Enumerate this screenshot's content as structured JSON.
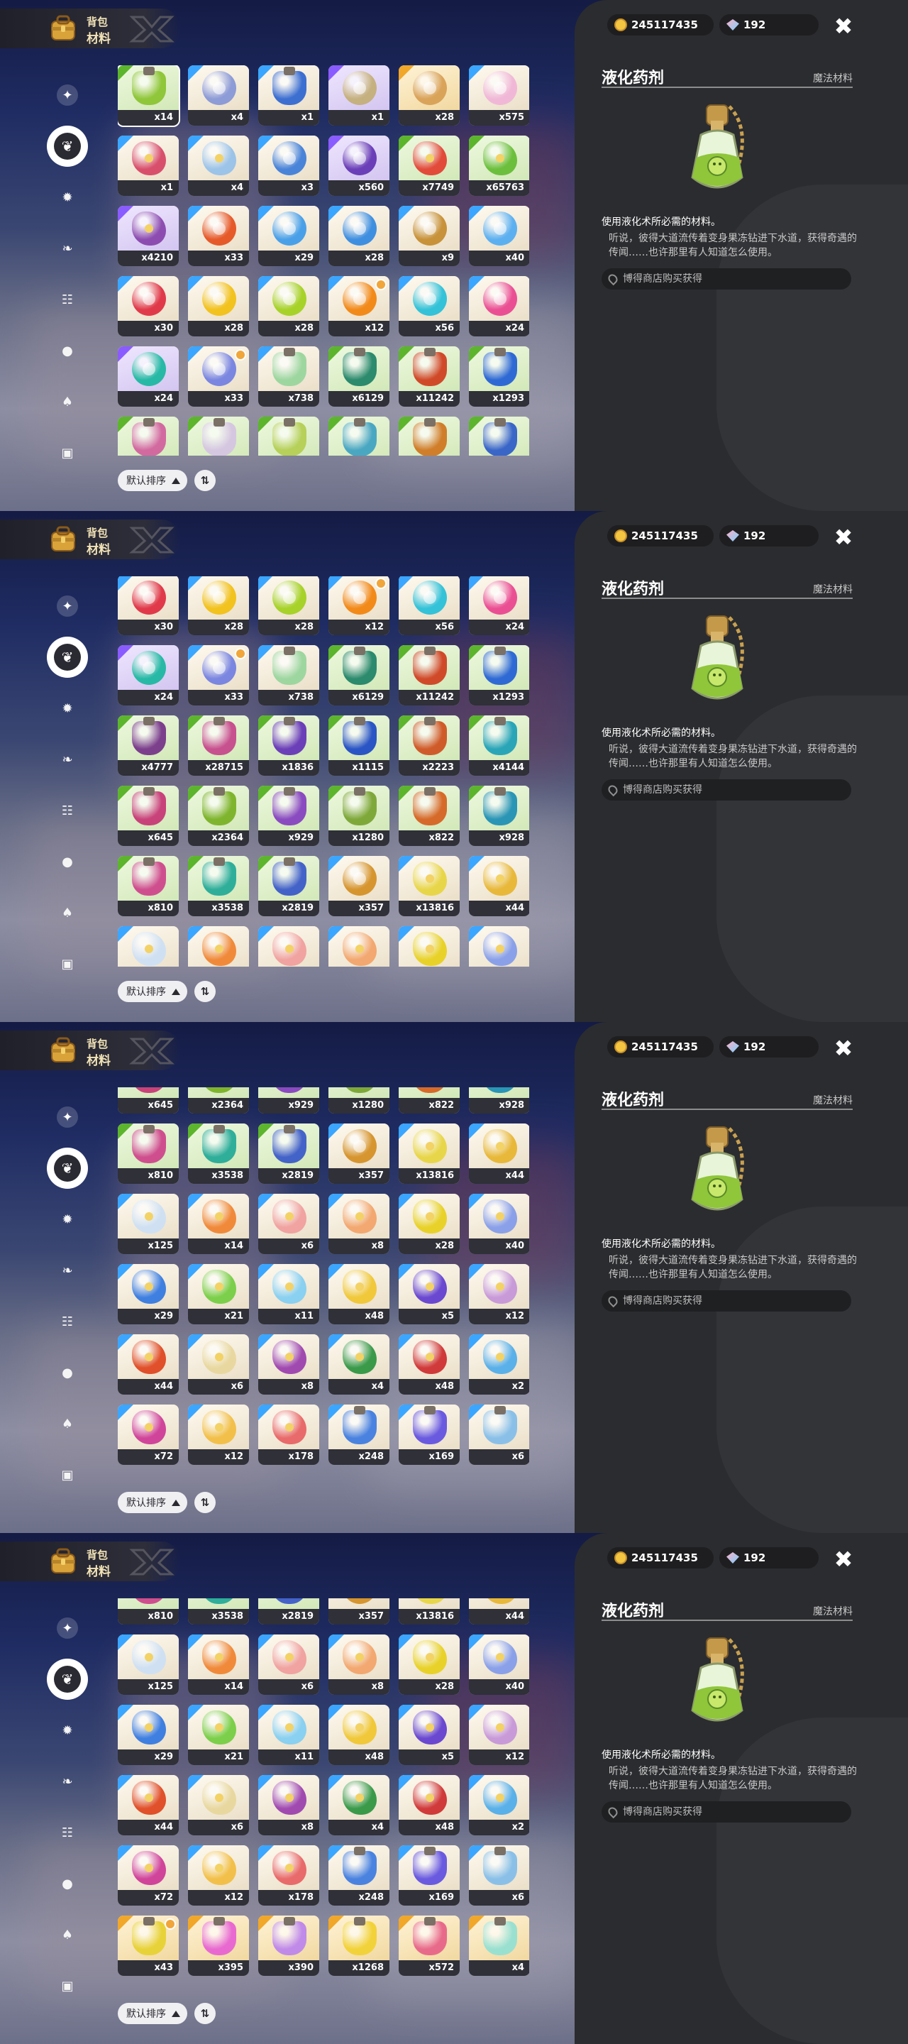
{
  "header": {
    "line1": "背包",
    "line2": "材料"
  },
  "currency": {
    "coins": "245117435",
    "gems": "192"
  },
  "close_label": "✖",
  "categories": [
    {
      "name": "star",
      "glyph": "✦"
    },
    {
      "name": "leaf",
      "glyph": "❦"
    },
    {
      "name": "gear",
      "glyph": "✹"
    },
    {
      "name": "feather",
      "glyph": "❧"
    },
    {
      "name": "chart",
      "glyph": "☷"
    },
    {
      "name": "ball",
      "glyph": "●"
    },
    {
      "name": "bell",
      "glyph": "♠"
    },
    {
      "name": "chest",
      "glyph": "▣"
    }
  ],
  "sort": {
    "label": "默认排序",
    "order_label": "⇅"
  },
  "detail": {
    "name": "液化药剂",
    "type": "魔法材料",
    "desc": "使用液化术所必需的材料。",
    "lore": "听说，彼得大道流传着变身果冻钻进下水道，获得奇遇的传闻……也许那里有人知道怎么使用。",
    "source": "博得商店购买获得"
  },
  "frames": [
    {
      "offset": 0,
      "cells": [
        {
          "c": "x14",
          "col": "#8fc63a",
          "shape": "bottle",
          "r": "green",
          "sel": true
        },
        {
          "c": "x4",
          "col": "#8d9bd6",
          "shape": "ring",
          "r": "blue"
        },
        {
          "c": "x1",
          "col": "#3d6fd1",
          "shape": "bottle",
          "r": "blue"
        },
        {
          "c": "x1",
          "col": "#c5b080",
          "shape": "ring",
          "r": "purple"
        },
        {
          "c": "x28",
          "col": "#d9a35a",
          "shape": "ring",
          "r": "gold"
        },
        {
          "c": "x575",
          "col": "#f0b8d6",
          "shape": "ring",
          "r": "blue"
        },
        {
          "c": "x1",
          "col": "#d84f6c",
          "shape": "flower",
          "r": "blue"
        },
        {
          "c": "x4",
          "col": "#9cc3e8",
          "shape": "flower",
          "r": "blue"
        },
        {
          "c": "x3",
          "col": "#4a84d8",
          "shape": "ring",
          "r": "blue"
        },
        {
          "c": "x560",
          "col": "#6b3fb8",
          "shape": "ring",
          "r": "purple"
        },
        {
          "c": "x7749",
          "col": "#e24a3a",
          "shape": "flower",
          "r": "green"
        },
        {
          "c": "x65763",
          "col": "#6cbf3c",
          "shape": "flower",
          "r": "green"
        },
        {
          "c": "x4210",
          "col": "#8d4db0",
          "shape": "flower",
          "r": "purple"
        },
        {
          "c": "x33",
          "col": "#e65a2a",
          "shape": "ring",
          "r": "blue"
        },
        {
          "c": "x29",
          "col": "#4aa0e8",
          "shape": "ring",
          "r": "blue"
        },
        {
          "c": "x28",
          "col": "#3f8fe0",
          "shape": "ring",
          "r": "blue"
        },
        {
          "c": "x9",
          "col": "#c7923a",
          "shape": "ring",
          "r": "blue"
        },
        {
          "c": "x40",
          "col": "#5db0f0",
          "shape": "ring",
          "r": "blue"
        },
        {
          "c": "x30",
          "col": "#e03a4a",
          "shape": "ring",
          "r": "blue"
        },
        {
          "c": "x28",
          "col": "#f2c21f",
          "shape": "ring",
          "r": "blue"
        },
        {
          "c": "x28",
          "col": "#a7d22a",
          "shape": "ring",
          "r": "blue"
        },
        {
          "c": "x12",
          "col": "#f28a1a",
          "shape": "ring",
          "r": "blue",
          "nw": true
        },
        {
          "c": "x56",
          "col": "#34c2d8",
          "shape": "ring",
          "r": "blue"
        },
        {
          "c": "x24",
          "col": "#ea4f93",
          "shape": "ring",
          "r": "blue"
        },
        {
          "c": "x24",
          "col": "#27b9a5",
          "shape": "ring",
          "r": "purple"
        },
        {
          "c": "x33",
          "col": "#7a86e0",
          "shape": "ring",
          "r": "blue",
          "nw": true
        },
        {
          "c": "x738",
          "col": "#9ed6a0",
          "shape": "bottle",
          "r": "blue"
        },
        {
          "c": "x6129",
          "col": "#2c8a6d",
          "shape": "bottle",
          "r": "green"
        },
        {
          "c": "x11242",
          "col": "#d04a2a",
          "shape": "bottle",
          "r": "green"
        },
        {
          "c": "x1293",
          "col": "#2f6ad4",
          "shape": "bottle",
          "r": "green"
        },
        {
          "c": "",
          "col": "#d26aa0",
          "shape": "bottle",
          "r": "green"
        },
        {
          "c": "",
          "col": "#d5c7e0",
          "shape": "bottle",
          "r": "green"
        },
        {
          "c": "",
          "col": "#b6d05a",
          "shape": "bottle",
          "r": "green"
        },
        {
          "c": "",
          "col": "#4aa7c2",
          "shape": "bottle",
          "r": "green"
        },
        {
          "c": "",
          "col": "#d07e2a",
          "shape": "bottle",
          "r": "green"
        },
        {
          "c": "",
          "col": "#3a66c8",
          "shape": "bottle",
          "r": "green"
        }
      ]
    },
    {
      "offset": -2,
      "cells": [
        {
          "c": "x30",
          "col": "#e03a4a",
          "shape": "ring",
          "r": "blue"
        },
        {
          "c": "x28",
          "col": "#f2c21f",
          "shape": "ring",
          "r": "blue"
        },
        {
          "c": "x28",
          "col": "#a7d22a",
          "shape": "ring",
          "r": "blue"
        },
        {
          "c": "x12",
          "col": "#f28a1a",
          "shape": "ring",
          "r": "blue",
          "nw": true
        },
        {
          "c": "x56",
          "col": "#34c2d8",
          "shape": "ring",
          "r": "blue"
        },
        {
          "c": "x24",
          "col": "#ea4f93",
          "shape": "ring",
          "r": "blue"
        },
        {
          "c": "x24",
          "col": "#27b9a5",
          "shape": "ring",
          "r": "purple"
        },
        {
          "c": "x33",
          "col": "#7a86e0",
          "shape": "ring",
          "r": "blue",
          "nw": true
        },
        {
          "c": "x738",
          "col": "#9ed6a0",
          "shape": "bottle",
          "r": "blue"
        },
        {
          "c": "x6129",
          "col": "#2c8a6d",
          "shape": "bottle",
          "r": "green"
        },
        {
          "c": "x11242",
          "col": "#d04a2a",
          "shape": "bottle",
          "r": "green"
        },
        {
          "c": "x1293",
          "col": "#2f6ad4",
          "shape": "bottle",
          "r": "green"
        },
        {
          "c": "x4777",
          "col": "#7c3f8c",
          "shape": "bottle",
          "r": "green"
        },
        {
          "c": "x28715",
          "col": "#c7508e",
          "shape": "bottle",
          "r": "green"
        },
        {
          "c": "x1836",
          "col": "#6b3fb8",
          "shape": "bottle",
          "r": "green"
        },
        {
          "c": "x1115",
          "col": "#2a55c4",
          "shape": "bottle",
          "r": "green"
        },
        {
          "c": "x2223",
          "col": "#d05b2a",
          "shape": "bottle",
          "r": "green"
        },
        {
          "c": "x4144",
          "col": "#2aa5b8",
          "shape": "bottle",
          "r": "green"
        },
        {
          "c": "x645",
          "col": "#c8437a",
          "shape": "bottle",
          "r": "green"
        },
        {
          "c": "x2364",
          "col": "#7fb52e",
          "shape": "bottle",
          "r": "green"
        },
        {
          "c": "x929",
          "col": "#8a4bc0",
          "shape": "bottle",
          "r": "green"
        },
        {
          "c": "x1280",
          "col": "#7fa83a",
          "shape": "bottle",
          "r": "green"
        },
        {
          "c": "x822",
          "col": "#d66a2a",
          "shape": "bottle",
          "r": "green"
        },
        {
          "c": "x928",
          "col": "#2a95b5",
          "shape": "bottle",
          "r": "green"
        },
        {
          "c": "x810",
          "col": "#cf4f8e",
          "shape": "bottle",
          "r": "green"
        },
        {
          "c": "x3538",
          "col": "#2fae9a",
          "shape": "bottle",
          "r": "green"
        },
        {
          "c": "x2819",
          "col": "#4463c8",
          "shape": "bottle",
          "r": "green"
        },
        {
          "c": "x357",
          "col": "#d6952f",
          "shape": "ring",
          "r": "blue"
        },
        {
          "c": "x13816",
          "col": "#e8d64a",
          "shape": "flower",
          "r": "blue"
        },
        {
          "c": "x44",
          "col": "#e8b83a",
          "shape": "flower",
          "r": "blue"
        },
        {
          "c": "",
          "col": "#cfe0f2",
          "shape": "flower",
          "r": "blue"
        },
        {
          "c": "",
          "col": "#f08a3a",
          "shape": "flower",
          "r": "blue"
        },
        {
          "c": "",
          "col": "#f0a3a0",
          "shape": "flower",
          "r": "blue"
        },
        {
          "c": "",
          "col": "#f2a870",
          "shape": "flower",
          "r": "blue"
        },
        {
          "c": "",
          "col": "#e8d22a",
          "shape": "flower",
          "r": "blue"
        },
        {
          "c": "",
          "col": "#8aa0e8",
          "shape": "flower",
          "r": "blue"
        }
      ]
    },
    {
      "offset": -48,
      "cells": [
        {
          "c": "x645",
          "col": "#c8437a",
          "shape": "bottle",
          "r": "green"
        },
        {
          "c": "x2364",
          "col": "#7fb52e",
          "shape": "bottle",
          "r": "green"
        },
        {
          "c": "x929",
          "col": "#8a4bc0",
          "shape": "bottle",
          "r": "green"
        },
        {
          "c": "x1280",
          "col": "#7fa83a",
          "shape": "bottle",
          "r": "green"
        },
        {
          "c": "x822",
          "col": "#d66a2a",
          "shape": "bottle",
          "r": "green"
        },
        {
          "c": "x928",
          "col": "#2a95b5",
          "shape": "bottle",
          "r": "green"
        },
        {
          "c": "x810",
          "col": "#cf4f8e",
          "shape": "bottle",
          "r": "green"
        },
        {
          "c": "x3538",
          "col": "#2fae9a",
          "shape": "bottle",
          "r": "green"
        },
        {
          "c": "x2819",
          "col": "#4463c8",
          "shape": "bottle",
          "r": "green"
        },
        {
          "c": "x357",
          "col": "#d6952f",
          "shape": "ring",
          "r": "blue"
        },
        {
          "c": "x13816",
          "col": "#e8d64a",
          "shape": "flower",
          "r": "blue"
        },
        {
          "c": "x44",
          "col": "#e8b83a",
          "shape": "flower",
          "r": "blue"
        },
        {
          "c": "x125",
          "col": "#cfe0f2",
          "shape": "flower",
          "r": "blue"
        },
        {
          "c": "x14",
          "col": "#f08a3a",
          "shape": "flower",
          "r": "blue"
        },
        {
          "c": "x6",
          "col": "#f0a3a0",
          "shape": "flower",
          "r": "blue"
        },
        {
          "c": "x8",
          "col": "#f2a870",
          "shape": "flower",
          "r": "blue"
        },
        {
          "c": "x28",
          "col": "#e8d22a",
          "shape": "flower",
          "r": "blue"
        },
        {
          "c": "x40",
          "col": "#8aa0e8",
          "shape": "flower",
          "r": "blue"
        },
        {
          "c": "x29",
          "col": "#3f7fe0",
          "shape": "flower",
          "r": "blue"
        },
        {
          "c": "x21",
          "col": "#7ccf4a",
          "shape": "flower",
          "r": "blue"
        },
        {
          "c": "x11",
          "col": "#8ad0f0",
          "shape": "flower",
          "r": "blue"
        },
        {
          "c": "x48",
          "col": "#f0c83a",
          "shape": "flower",
          "r": "blue"
        },
        {
          "c": "x5",
          "col": "#6a48d0",
          "shape": "flower",
          "r": "blue"
        },
        {
          "c": "x12",
          "col": "#c89ad8",
          "shape": "flower",
          "r": "blue"
        },
        {
          "c": "x44",
          "col": "#e0502a",
          "shape": "flower",
          "r": "blue"
        },
        {
          "c": "x6",
          "col": "#e8d8a0",
          "shape": "flower",
          "r": "blue"
        },
        {
          "c": "x8",
          "col": "#a04ab0",
          "shape": "flower",
          "r": "blue"
        },
        {
          "c": "x4",
          "col": "#3a9a4a",
          "shape": "flower",
          "r": "blue"
        },
        {
          "c": "x48",
          "col": "#d03a3a",
          "shape": "flower",
          "r": "blue"
        },
        {
          "c": "x2",
          "col": "#5ab0e8",
          "shape": "flower",
          "r": "blue"
        },
        {
          "c": "x72",
          "col": "#d0449a",
          "shape": "flower",
          "r": "blue"
        },
        {
          "c": "x12",
          "col": "#f2c04a",
          "shape": "flower",
          "r": "blue"
        },
        {
          "c": "x178",
          "col": "#e86a6a",
          "shape": "flower",
          "r": "blue"
        },
        {
          "c": "x248",
          "col": "#4a82e0",
          "shape": "bottle",
          "r": "blue"
        },
        {
          "c": "x169",
          "col": "#6a5ae0",
          "shape": "bottle",
          "r": "blue"
        },
        {
          "c": "x6",
          "col": "#8ac0e8",
          "shape": "bottle",
          "r": "blue"
        }
      ]
    },
    {
      "offset": -48,
      "cells": [
        {
          "c": "x810",
          "col": "#cf4f8e",
          "shape": "bottle",
          "r": "green"
        },
        {
          "c": "x3538",
          "col": "#2fae9a",
          "shape": "bottle",
          "r": "green"
        },
        {
          "c": "x2819",
          "col": "#4463c8",
          "shape": "bottle",
          "r": "green"
        },
        {
          "c": "x357",
          "col": "#d6952f",
          "shape": "ring",
          "r": "blue"
        },
        {
          "c": "x13816",
          "col": "#e8d64a",
          "shape": "flower",
          "r": "blue"
        },
        {
          "c": "x44",
          "col": "#e8b83a",
          "shape": "flower",
          "r": "blue"
        },
        {
          "c": "x125",
          "col": "#cfe0f2",
          "shape": "flower",
          "r": "blue"
        },
        {
          "c": "x14",
          "col": "#f08a3a",
          "shape": "flower",
          "r": "blue"
        },
        {
          "c": "x6",
          "col": "#f0a3a0",
          "shape": "flower",
          "r": "blue"
        },
        {
          "c": "x8",
          "col": "#f2a870",
          "shape": "flower",
          "r": "blue"
        },
        {
          "c": "x28",
          "col": "#e8d22a",
          "shape": "flower",
          "r": "blue"
        },
        {
          "c": "x40",
          "col": "#8aa0e8",
          "shape": "flower",
          "r": "blue"
        },
        {
          "c": "x29",
          "col": "#3f7fe0",
          "shape": "flower",
          "r": "blue"
        },
        {
          "c": "x21",
          "col": "#7ccf4a",
          "shape": "flower",
          "r": "blue"
        },
        {
          "c": "x11",
          "col": "#8ad0f0",
          "shape": "flower",
          "r": "blue"
        },
        {
          "c": "x48",
          "col": "#f0c83a",
          "shape": "flower",
          "r": "blue"
        },
        {
          "c": "x5",
          "col": "#6a48d0",
          "shape": "flower",
          "r": "blue"
        },
        {
          "c": "x12",
          "col": "#c89ad8",
          "shape": "flower",
          "r": "blue"
        },
        {
          "c": "x44",
          "col": "#e0502a",
          "shape": "flower",
          "r": "blue"
        },
        {
          "c": "x6",
          "col": "#e8d8a0",
          "shape": "flower",
          "r": "blue"
        },
        {
          "c": "x8",
          "col": "#a04ab0",
          "shape": "flower",
          "r": "blue"
        },
        {
          "c": "x4",
          "col": "#3a9a4a",
          "shape": "flower",
          "r": "blue"
        },
        {
          "c": "x48",
          "col": "#d03a3a",
          "shape": "flower",
          "r": "blue"
        },
        {
          "c": "x2",
          "col": "#5ab0e8",
          "shape": "flower",
          "r": "blue"
        },
        {
          "c": "x72",
          "col": "#d0449a",
          "shape": "flower",
          "r": "blue"
        },
        {
          "c": "x12",
          "col": "#f2c04a",
          "shape": "flower",
          "r": "blue"
        },
        {
          "c": "x178",
          "col": "#e86a6a",
          "shape": "flower",
          "r": "blue"
        },
        {
          "c": "x248",
          "col": "#4a82e0",
          "shape": "bottle",
          "r": "blue"
        },
        {
          "c": "x169",
          "col": "#6a5ae0",
          "shape": "bottle",
          "r": "blue"
        },
        {
          "c": "x6",
          "col": "#8ac0e8",
          "shape": "bottle",
          "r": "blue"
        },
        {
          "c": "x43",
          "col": "#e8d23a",
          "shape": "bottle",
          "r": "gold",
          "nw": true
        },
        {
          "c": "x395",
          "col": "#e86ad0",
          "shape": "bottle",
          "r": "gold"
        },
        {
          "c": "x390",
          "col": "#c08ae8",
          "shape": "bottle",
          "r": "gold"
        },
        {
          "c": "x1268",
          "col": "#f2d23a",
          "shape": "bottle",
          "r": "gold"
        },
        {
          "c": "x572",
          "col": "#e86a8a",
          "shape": "bottle",
          "r": "gold"
        },
        {
          "c": "x4",
          "col": "#9ae0d0",
          "shape": "bottle",
          "r": "gold"
        }
      ]
    }
  ]
}
